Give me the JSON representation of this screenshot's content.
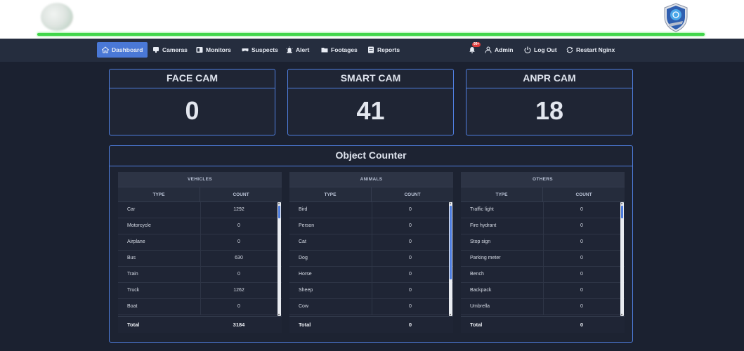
{
  "nav": {
    "dashboard": "Dashboard",
    "cameras": "Cameras",
    "monitors": "Monitors",
    "suspects": "Suspects",
    "alert": "Alert",
    "footages": "Footages",
    "reports": "Reports",
    "notification_badge": "99+",
    "admin": "Admin",
    "logout": "Log Out",
    "restart": "Restart Nginx"
  },
  "cams": [
    {
      "title": "FACE CAM",
      "count": "0"
    },
    {
      "title": "SMART CAM",
      "count": "41"
    },
    {
      "title": "ANPR CAM",
      "count": "18"
    }
  ],
  "object_counter": {
    "title": "Object Counter",
    "col_type": "TYPE",
    "col_count": "COUNT",
    "total_label": "Total",
    "vehicles": {
      "heading": "VEHICLES",
      "rows": [
        {
          "type": "Car",
          "count": "1292"
        },
        {
          "type": "Motorcycle",
          "count": "0"
        },
        {
          "type": "Airplane",
          "count": "0"
        },
        {
          "type": "Bus",
          "count": "630"
        },
        {
          "type": "Train",
          "count": "0"
        },
        {
          "type": "Truck",
          "count": "1262"
        },
        {
          "type": "Boat",
          "count": "0"
        }
      ],
      "total": "3184"
    },
    "animals": {
      "heading": "ANIMALS",
      "rows": [
        {
          "type": "Bird",
          "count": "0"
        },
        {
          "type": "Person",
          "count": "0"
        },
        {
          "type": "Cat",
          "count": "0"
        },
        {
          "type": "Dog",
          "count": "0"
        },
        {
          "type": "Horse",
          "count": "0"
        },
        {
          "type": "Sheep",
          "count": "0"
        },
        {
          "type": "Cow",
          "count": "0"
        }
      ],
      "total": "0"
    },
    "others": {
      "heading": "OTHERS",
      "rows": [
        {
          "type": "Traffic light",
          "count": "0"
        },
        {
          "type": "Fire hydrant",
          "count": "0"
        },
        {
          "type": "Stop sign",
          "count": "0"
        },
        {
          "type": "Parking meter",
          "count": "0"
        },
        {
          "type": "Bench",
          "count": "0"
        },
        {
          "type": "Backpack",
          "count": "0"
        },
        {
          "type": "Umbrella",
          "count": "0"
        }
      ],
      "total": "0"
    }
  },
  "colors": {
    "accent": "#4a78d6",
    "border": "#4f7fe0",
    "progress": "#41d64a",
    "badge": "#e03b3b"
  }
}
